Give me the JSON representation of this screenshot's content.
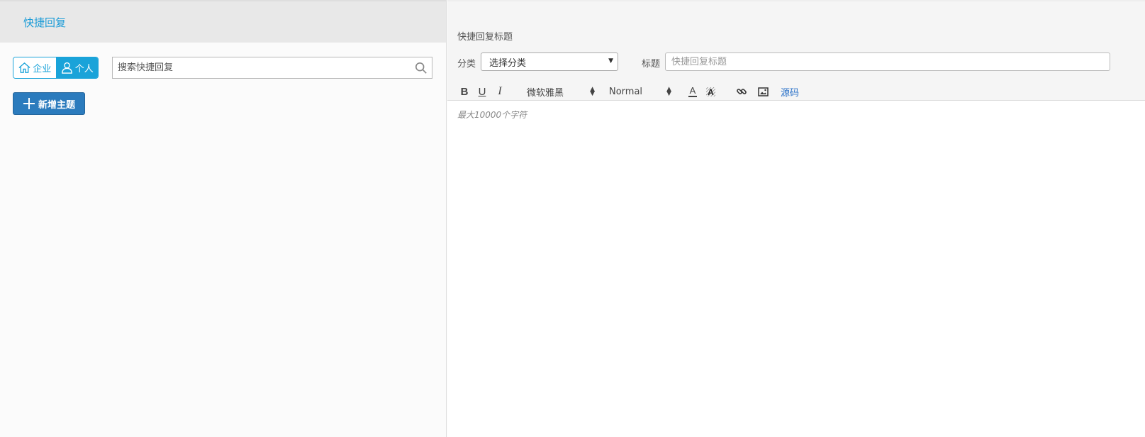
{
  "left": {
    "header_title": "快捷回复",
    "scope": {
      "company_label": "企业",
      "personal_label": "个人"
    },
    "search": {
      "placeholder": "搜索快捷回复",
      "value": ""
    },
    "add_topic_label": "新增主题"
  },
  "right": {
    "section_label": "快捷回复标题",
    "category_label": "分类",
    "category_selected": "选择分类",
    "title_label": "标题",
    "title_placeholder": "快捷回复标题",
    "toolbar": {
      "bold": "B",
      "underline": "U",
      "italic": "I",
      "font_family": "微软雅黑",
      "font_size": "Normal",
      "text_color": "A",
      "source_label": "源码"
    },
    "editor_placeholder": "最大10000个字符"
  },
  "colors": {
    "accent": "#1aa3d9",
    "primary_button": "#2b7bbd",
    "link": "#2870c8"
  },
  "icons": [
    "home-icon",
    "user-icon",
    "search-icon",
    "plus-icon",
    "link-icon",
    "image-icon",
    "background-color-icon"
  ]
}
